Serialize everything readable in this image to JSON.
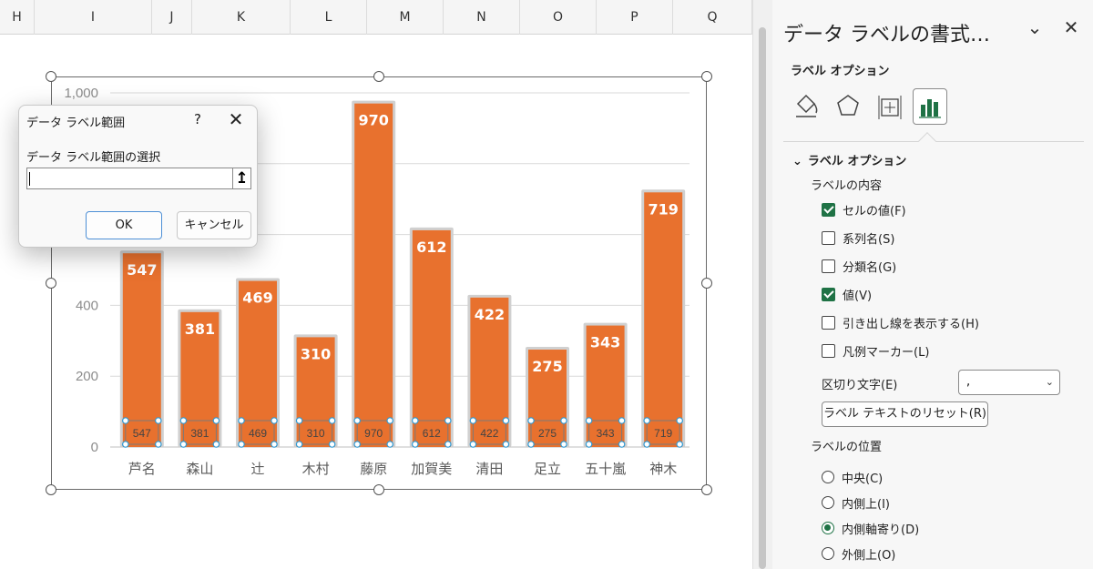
{
  "sheet": {
    "columns": [
      "H",
      "I",
      "J",
      "K",
      "L",
      "M",
      "N",
      "O",
      "P",
      "Q"
    ]
  },
  "chart_data": {
    "type": "bar",
    "categories": [
      "芦名",
      "森山",
      "辻",
      "木村",
      "藤原",
      "加賀美",
      "清田",
      "足立",
      "五十嵐",
      "神木"
    ],
    "values": [
      547,
      381,
      469,
      310,
      970,
      612,
      422,
      275,
      343,
      719
    ],
    "yticks": [
      "0",
      "200",
      "400",
      "1,000"
    ],
    "ylim": [
      0,
      1000
    ],
    "bar_color": "#e8712e",
    "grid": true
  },
  "dialog": {
    "title": "データ ラベル範囲",
    "help": "?",
    "close": "✕",
    "label": "データ ラベル範囲の選択",
    "input_value": "",
    "collapse_icon": "↥",
    "ok": "OK",
    "cancel": "キャンセル"
  },
  "pane": {
    "title": "データ ラベルの書式…",
    "chevron": "⌄",
    "close": "✕",
    "subtitle": "ラベル オプション",
    "icons": [
      "fill-line-icon",
      "effects-pentagon-icon",
      "size-properties-icon",
      "label-options-bar-icon"
    ],
    "section": "ラベル オプション",
    "content_header": "ラベルの内容",
    "checkboxes": [
      {
        "label": "セルの値(F)",
        "checked": true
      },
      {
        "label": "系列名(S)",
        "checked": false
      },
      {
        "label": "分類名(G)",
        "checked": false
      },
      {
        "label": "値(V)",
        "checked": true
      },
      {
        "label": "引き出し線を表示する(H)",
        "checked": false
      },
      {
        "label": "凡例マーカー(L)",
        "checked": false
      }
    ],
    "separator_label": "区切り文字(E)",
    "separator_value": ",",
    "reset_label": "ラベル テキストのリセット(R)",
    "position_header": "ラベルの位置",
    "radios": [
      {
        "label": "中央(C)",
        "selected": false
      },
      {
        "label": "内側上(I)",
        "selected": false
      },
      {
        "label": "内側軸寄り(D)",
        "selected": true
      },
      {
        "label": "外側上(O)",
        "selected": false
      }
    ],
    "accent_color": "#1f7245"
  }
}
